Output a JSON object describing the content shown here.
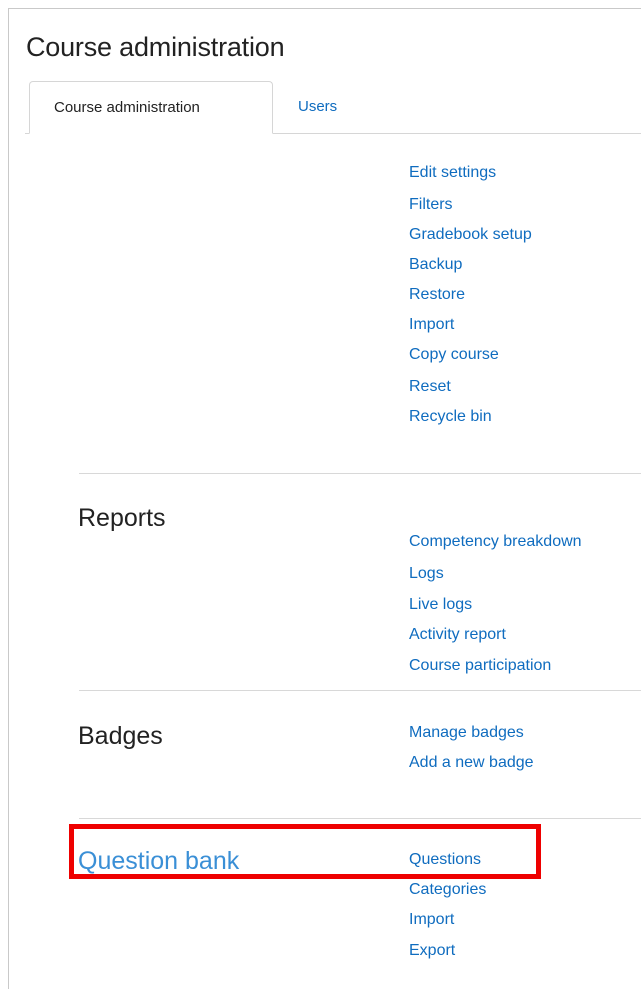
{
  "page": {
    "title": "Course administration"
  },
  "tabs": [
    {
      "label": "Course administration",
      "active": true
    },
    {
      "label": "Users",
      "active": false
    }
  ],
  "course_links": [
    "Edit settings",
    "Filters",
    "Gradebook setup",
    "Backup",
    "Restore",
    "Import",
    "Copy course",
    "Reset",
    "Recycle bin"
  ],
  "reports": {
    "title": "Reports",
    "links": [
      "Competency breakdown",
      "Logs",
      "Live logs",
      "Activity report",
      "Course participation"
    ]
  },
  "badges": {
    "title": "Badges",
    "links": [
      "Manage badges",
      "Add a new badge"
    ]
  },
  "question_bank": {
    "title": "Question bank",
    "links": [
      "Questions",
      "Categories",
      "Import",
      "Export"
    ]
  },
  "colors": {
    "link": "#0f6cbf",
    "highlight": "#ee0000",
    "question_bank_title": "#3a8fd6"
  }
}
